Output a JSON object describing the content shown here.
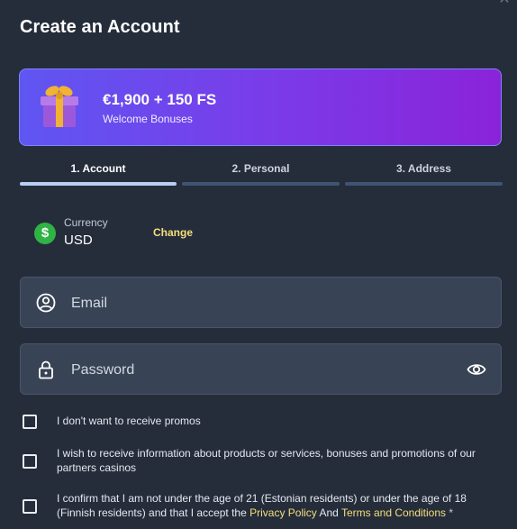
{
  "header": {
    "title": "Create an Account"
  },
  "bonus": {
    "amount": "€1,900 + 150 FS",
    "label": "Welcome Bonuses"
  },
  "steps": [
    {
      "label": "1.  Account",
      "active": true
    },
    {
      "label": "2.  Personal",
      "active": false
    },
    {
      "label": "3.  Address",
      "active": false
    }
  ],
  "currency": {
    "label": "Currency",
    "value": "USD",
    "change_label": "Change"
  },
  "form": {
    "email_placeholder": "Email",
    "password_placeholder": "Password"
  },
  "consents": {
    "promos": "I don't want to receive promos",
    "partners": "I wish to receive information about products or services, bonuses and promotions of our partners casinos",
    "age_prefix": "I confirm that I am not under the age of 21 (Estonian residents) or under the age of 18 (Finnish residents) and that I accept the",
    "privacy_link": "Privacy Policy",
    "and_word": "And",
    "terms_link": "Terms and Conditions",
    "required_mark": "*"
  },
  "icons": {
    "close": "close-icon",
    "gift": "gift-icon",
    "currency": "dollar-coin-icon",
    "email": "user-circle-icon",
    "password": "lock-icon",
    "toggle": "eye-icon"
  },
  "colors": {
    "background": "#252d3b",
    "accent_link": "#f5de7a",
    "bonus_gradient_start": "#5f56f2",
    "bonus_gradient_end": "#8a23d8",
    "step_active": "#b8cdf0",
    "step_inactive": "#3f5475"
  }
}
